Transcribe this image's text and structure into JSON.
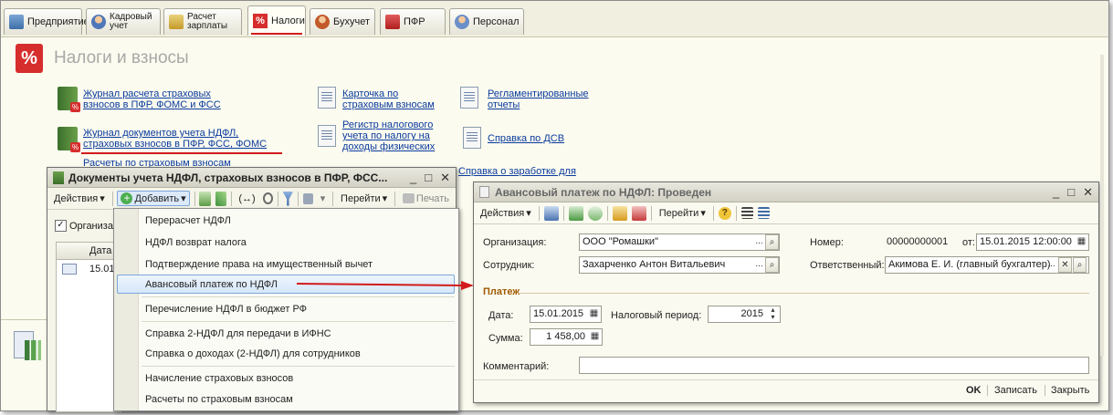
{
  "tabs": [
    {
      "label": "Предприятие",
      "icon": "enterprise-icon"
    },
    {
      "label": "Кадровый\nучет",
      "icon": "hr-icon"
    },
    {
      "label": "Расчет\nзарплаты",
      "icon": "payroll-icon"
    },
    {
      "label": "Налоги",
      "icon": "percent-icon"
    },
    {
      "label": "Бухучет",
      "icon": "accounting-icon"
    },
    {
      "label": "ПФР",
      "icon": "pension-icon"
    },
    {
      "label": "Персонал",
      "icon": "staff-icon"
    }
  ],
  "section": {
    "title": "Налоги и взносы",
    "logo": "%"
  },
  "links": {
    "journal_insurance": "Журнал расчета страховых\nвзносов в ПФР, ФОМС и ФСС",
    "journal_ndfl": "Журнал документов учета НДФЛ,\nстраховых взносов в ПФР, ФСС, ФОМС",
    "insurance_calc_partial": "Расчеты по страховым взносам",
    "card_insurance": "Карточка по\nстраховым взносам",
    "tax_register": "Регистр налогового\nучета по налогу на\nдоходы физических",
    "reglamented": "Регламентированные\nотчеты",
    "dsv_help": "Справка по ДСВ",
    "salary_help": "Справка о заработке для\nрасчета пособий"
  },
  "journal_window": {
    "title": "Документы учета НДФЛ, страховых взносов в ПФР, ФСС...",
    "toolbar": {
      "actions": "Действия",
      "add": "Добавить",
      "goto": "Перейти",
      "print": "Печать"
    },
    "filter_label": "Организа",
    "table_header": "Дата",
    "row_date": "15.01"
  },
  "add_menu": {
    "items": [
      "Перерасчет НДФЛ",
      "НДФЛ возврат налога",
      "Подтверждение права на имущественный вычет",
      "Авансовый платеж по НДФЛ",
      "Перечисление НДФЛ в бюджет РФ",
      "Справка 2-НДФЛ для передачи в ИФНС",
      "Справка о доходах (2-НДФЛ) для сотрудников",
      "Начисление страховых взносов",
      "Расчеты по страховым взносам"
    ],
    "highlighted_index": 3
  },
  "form": {
    "title": "Авансовый платеж по НДФЛ: Проведен",
    "toolbar": {
      "actions": "Действия",
      "goto": "Перейти"
    },
    "org_label": "Организация:",
    "org_value": "ООО \"Ромашки\"",
    "employee_label": "Сотрудник:",
    "employee_value": "Захарченко Антон Витальевич",
    "number_label": "Номер:",
    "number_value": "00000000001",
    "from_label": "от:",
    "from_value": "15.01.2015 12:00:00",
    "responsible_label": "Ответственный:",
    "responsible_value": "Акимова Е. И. (главный бухгалтер)",
    "payment_section": "Платеж",
    "date_label": "Дата:",
    "date_value": "15.01.2015",
    "period_label": "Налоговый период:",
    "period_value": "2015",
    "sum_label": "Сумма:",
    "sum_value": "1 458,00",
    "comment_label": "Комментарий:",
    "comment_value": "",
    "ok": "OK",
    "save": "Записать",
    "close": "Закрыть"
  },
  "colors": {
    "accent_red": "#d62d2d",
    "link": "#0b3b9e",
    "highlight": "#d6e7fa"
  }
}
